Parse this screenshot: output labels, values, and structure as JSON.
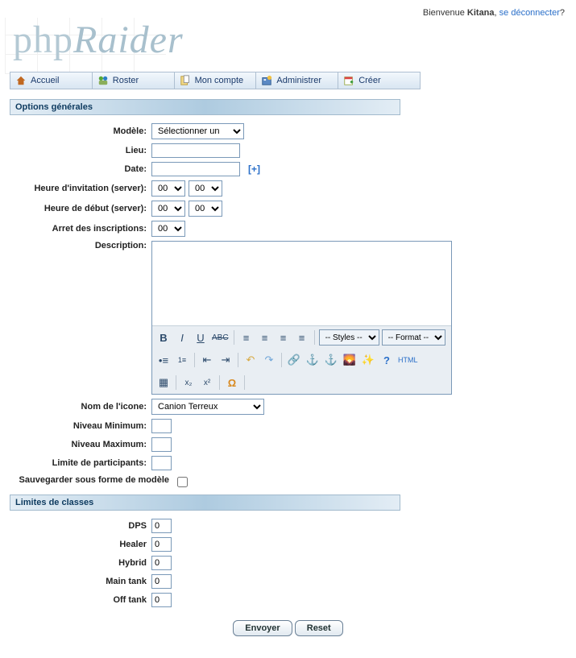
{
  "topbar": {
    "welcome": "Bienvenue ",
    "username": "Kitana",
    "separator": ", ",
    "logout": "se déconnecter",
    "trailing": "?"
  },
  "logo": {
    "php": "php",
    "raider": "Raider"
  },
  "nav": {
    "items": [
      {
        "label": "Accueil",
        "icon": "home-icon"
      },
      {
        "label": "Roster",
        "icon": "roster-icon"
      },
      {
        "label": "Mon compte",
        "icon": "account-icon"
      },
      {
        "label": "Administrer",
        "icon": "admin-icon"
      },
      {
        "label": "Créer",
        "icon": "create-icon"
      }
    ]
  },
  "section": {
    "general": "Options générales",
    "classes": "Limites de classes"
  },
  "labels": {
    "modele": "Modèle:",
    "lieu": "Lieu:",
    "date": "Date:",
    "heure_inv": "Heure d'invitation (server):",
    "heure_deb": "Heure de début (server):",
    "arret_insc": "Arret des inscriptions:",
    "description": "Description:",
    "nom_icone": "Nom de l'icone:",
    "niveau_min": "Niveau Minimum:",
    "niveau_max": "Niveau Maximum:",
    "limite_part": "Limite de participants:",
    "save_modele": "Sauvegarder sous forme de modèle",
    "dps": "DPS",
    "healer": "Healer",
    "hybrid": "Hybrid",
    "main_tank": "Main tank",
    "off_tank": "Off tank"
  },
  "values": {
    "modele_selected": "Sélectionner un",
    "lieu": "",
    "date": "",
    "date_plus": "[+]",
    "inv_h": "00",
    "inv_m": "00",
    "deb_h": "00",
    "deb_m": "00",
    "arret_h": "00",
    "description": "",
    "icone_selected": "Canion Terreux",
    "niveau_min": "",
    "niveau_max": "",
    "limite_part": "",
    "save_modele_checked": false,
    "dps": "0",
    "healer": "0",
    "hybrid": "0",
    "main_tank": "0",
    "off_tank": "0"
  },
  "richtext": {
    "styles_label": "-- Styles --",
    "format_label": "-- Format --",
    "html_label": "HTML"
  },
  "buttons": {
    "submit": "Envoyer",
    "reset": "Reset"
  }
}
